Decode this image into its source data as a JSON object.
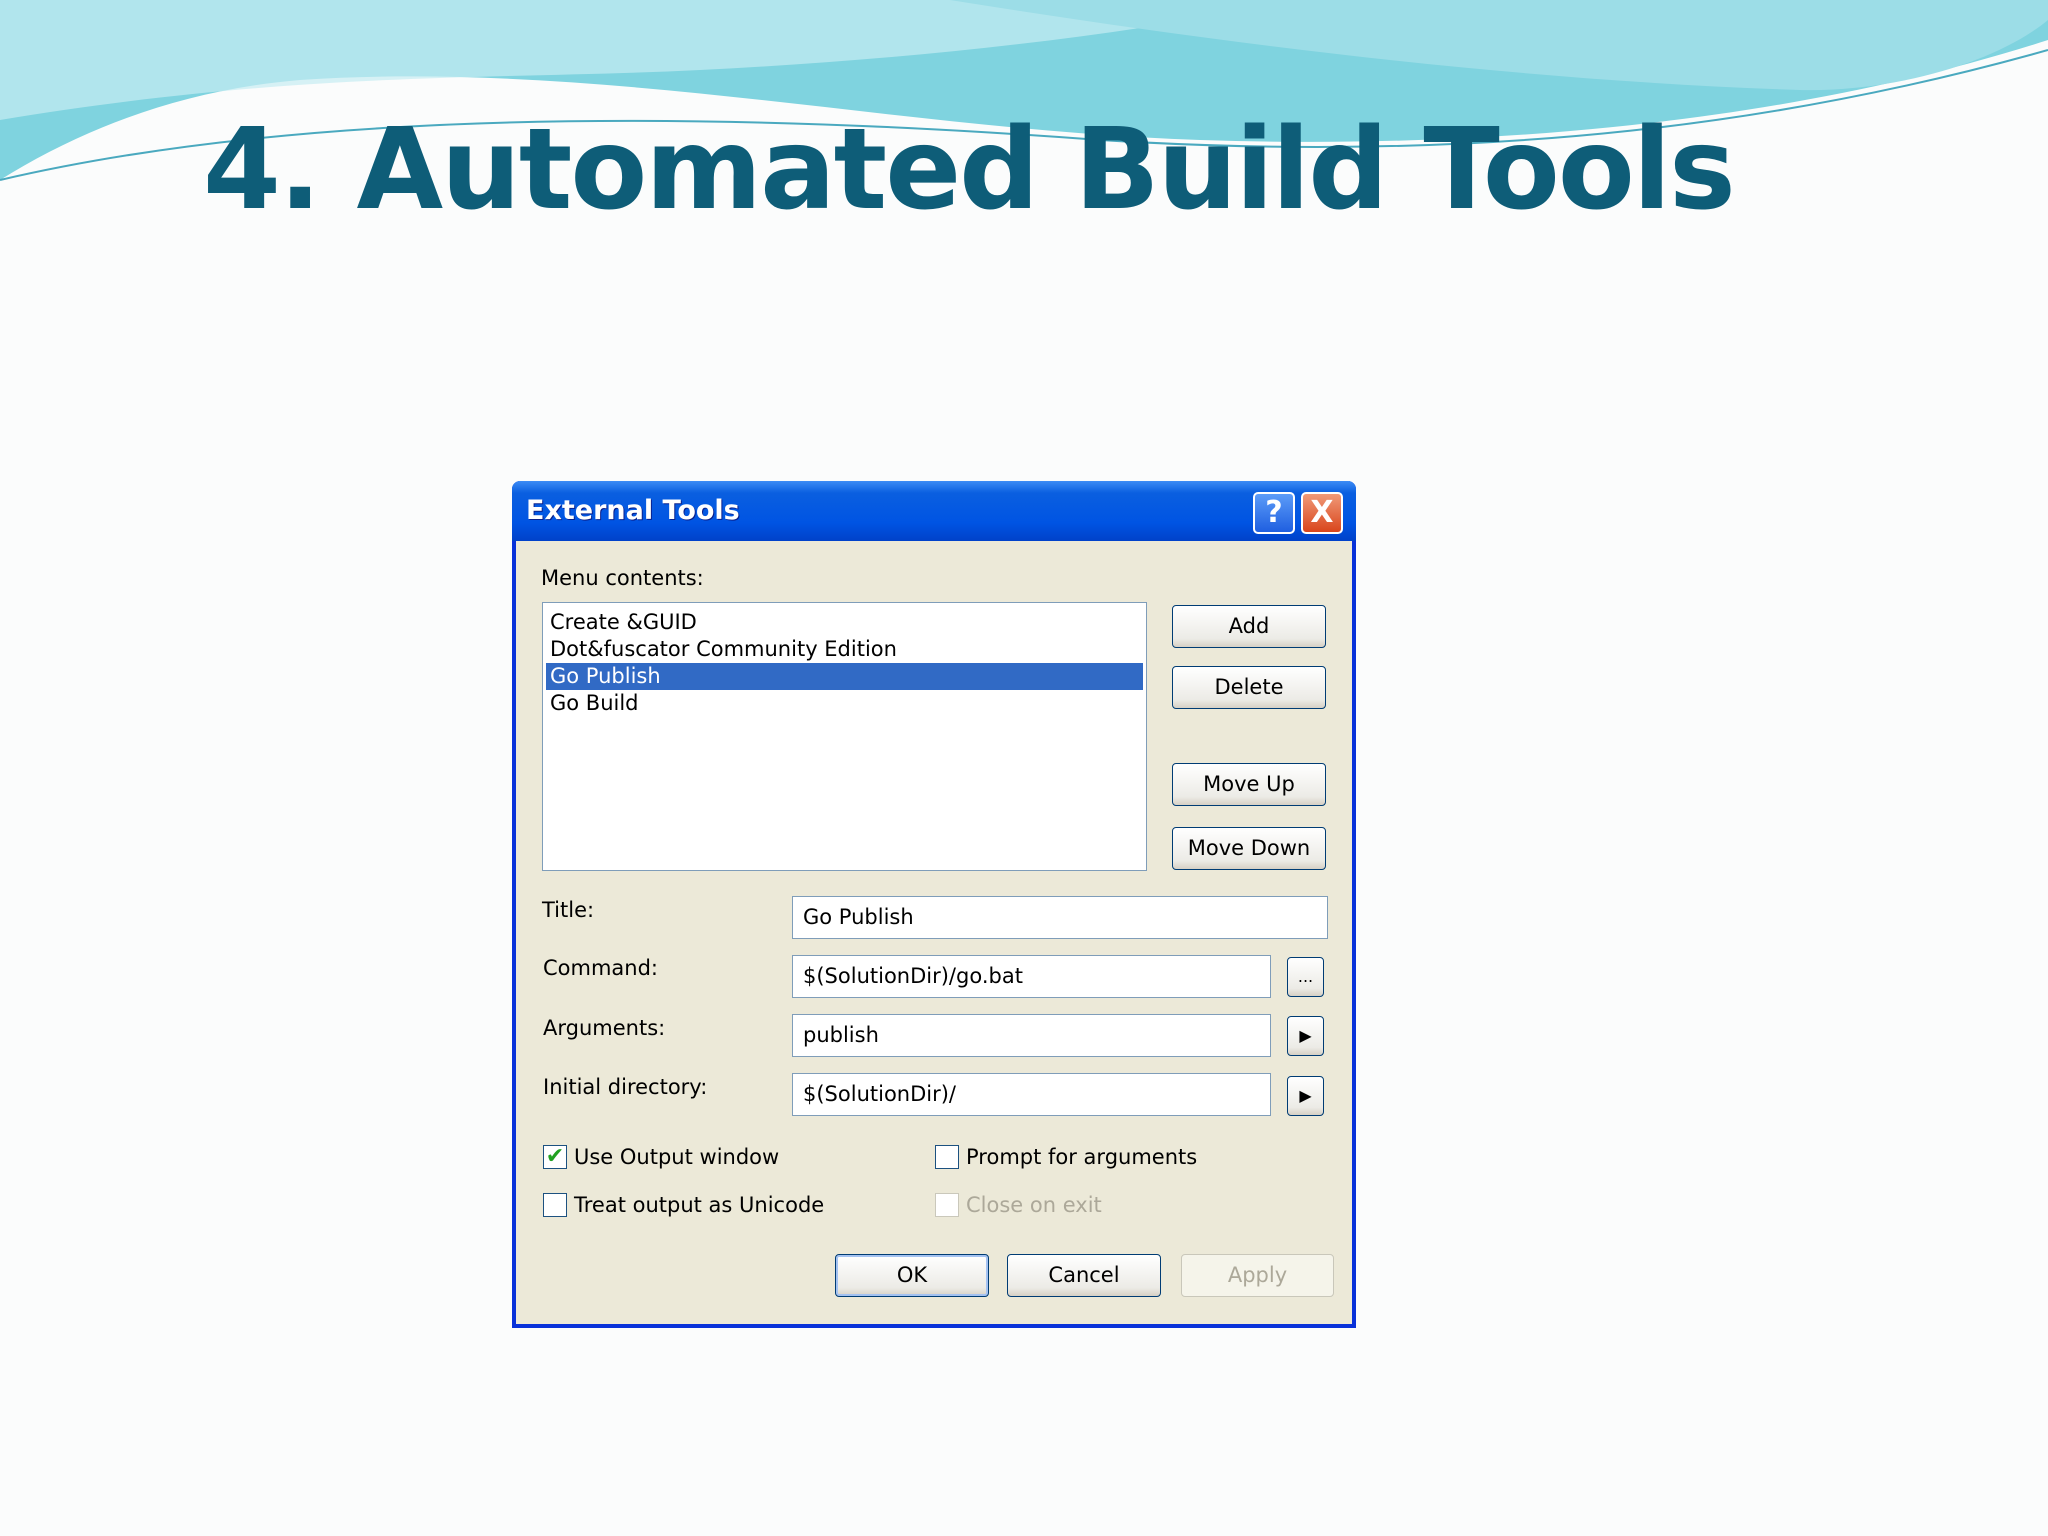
{
  "slide": {
    "title": "4. Automated Build Tools"
  },
  "dialog": {
    "title": "External Tools",
    "help_label": "?",
    "close_label": "X",
    "menu_contents_label": "Menu contents:",
    "menu_items": [
      {
        "label": "Create &GUID",
        "selected": false
      },
      {
        "label": "Dot&fuscator Community Edition",
        "selected": false
      },
      {
        "label": "Go Publish",
        "selected": true
      },
      {
        "label": "Go Build",
        "selected": false
      }
    ],
    "buttons": {
      "add": "Add",
      "delete": "Delete",
      "move_up": "Move Up",
      "move_down": "Move Down",
      "ok": "OK",
      "cancel": "Cancel",
      "apply": "Apply",
      "browse": "...",
      "arrow": "▶"
    },
    "fields": {
      "title": {
        "label": "Title:",
        "value": "Go Publish"
      },
      "command": {
        "label": "Command:",
        "value": "$(SolutionDir)/go.bat"
      },
      "arguments": {
        "label": "Arguments:",
        "value": "publish"
      },
      "initial_directory": {
        "label": "Initial directory:",
        "value": "$(SolutionDir)/"
      }
    },
    "checkboxes": {
      "use_output_window": {
        "label": "Use Output window",
        "checked": true
      },
      "prompt_for_arguments": {
        "label": "Prompt for arguments",
        "checked": false
      },
      "treat_output_unicode": {
        "label": "Treat output as Unicode",
        "checked": false
      },
      "close_on_exit": {
        "label": "Close on exit",
        "checked": false,
        "disabled": true
      }
    },
    "check_mark": "✔"
  },
  "colors": {
    "title_text": "#0e5d78",
    "titlebar": "#0054e3",
    "selection": "#316ac5",
    "dialog_bg": "#ece9d8"
  }
}
